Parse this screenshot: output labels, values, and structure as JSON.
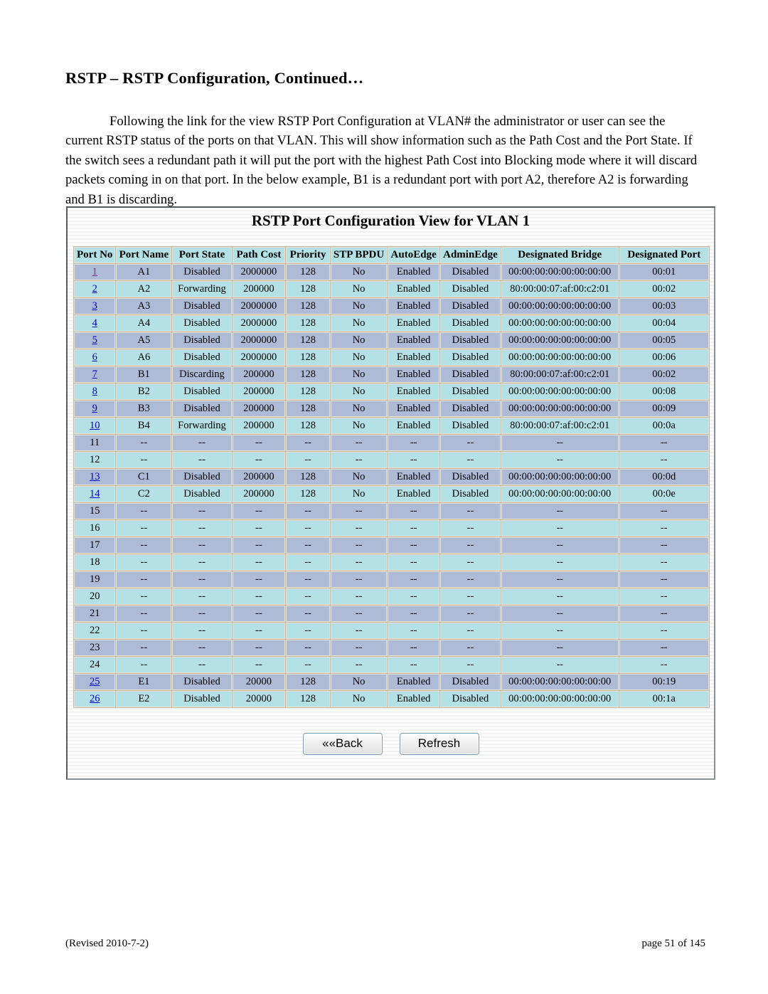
{
  "document": {
    "heading": "RSTP – RSTP Configuration, Continued…",
    "paragraph": "Following the link for the view RSTP Port Configuration at VLAN# the administrator or user can see the current RSTP status of the ports on that VLAN.  This will show information such as the Path Cost and the Port State.  If the switch sees a redundant path it will put the port with the highest Path Cost into Blocking mode where it will discard packets coming in on that port. In the below example, B1 is a redundant port with port A2, therefore A2 is forwarding and B1 is discarding.",
    "footer_left": "(Revised 2010-7-2)",
    "footer_right": "page 51 of 145"
  },
  "screenshot": {
    "title": "RSTP Port Configuration View for VLAN 1",
    "colors": {
      "header_bg": "#b4e1e6",
      "row_odd_bg": "#aebbd6",
      "row_even_bg": "#b4e1e6",
      "grid": "#e8e2d2",
      "link": "#0000cc",
      "link_visited": "#8c2a8c"
    },
    "table": {
      "columns": [
        "Port No",
        "Port Name",
        "Port State",
        "Path Cost",
        "Priority",
        "STP BPDU",
        "AutoEdge",
        "AdminEdge",
        "Designated Bridge",
        "Designated Port"
      ],
      "rows": [
        {
          "port_no": "1",
          "link": true,
          "visited": true,
          "port_name": "A1",
          "port_state": "Disabled",
          "path_cost": "2000000",
          "priority": "128",
          "stp_bpdu": "No",
          "auto_edge": "Enabled",
          "admin_edge": "Disabled",
          "designated_bridge": "00:00:00:00:00:00:00:00",
          "designated_port": "00:01"
        },
        {
          "port_no": "2",
          "link": true,
          "visited": false,
          "port_name": "A2",
          "port_state": "Forwarding",
          "path_cost": "200000",
          "priority": "128",
          "stp_bpdu": "No",
          "auto_edge": "Enabled",
          "admin_edge": "Disabled",
          "designated_bridge": "80:00:00:07:af:00:c2:01",
          "designated_port": "00:02"
        },
        {
          "port_no": "3",
          "link": true,
          "visited": false,
          "port_name": "A3",
          "port_state": "Disabled",
          "path_cost": "2000000",
          "priority": "128",
          "stp_bpdu": "No",
          "auto_edge": "Enabled",
          "admin_edge": "Disabled",
          "designated_bridge": "00:00:00:00:00:00:00:00",
          "designated_port": "00:03"
        },
        {
          "port_no": "4",
          "link": true,
          "visited": false,
          "port_name": "A4",
          "port_state": "Disabled",
          "path_cost": "2000000",
          "priority": "128",
          "stp_bpdu": "No",
          "auto_edge": "Enabled",
          "admin_edge": "Disabled",
          "designated_bridge": "00:00:00:00:00:00:00:00",
          "designated_port": "00:04"
        },
        {
          "port_no": "5",
          "link": true,
          "visited": false,
          "port_name": "A5",
          "port_state": "Disabled",
          "path_cost": "2000000",
          "priority": "128",
          "stp_bpdu": "No",
          "auto_edge": "Enabled",
          "admin_edge": "Disabled",
          "designated_bridge": "00:00:00:00:00:00:00:00",
          "designated_port": "00:05"
        },
        {
          "port_no": "6",
          "link": true,
          "visited": false,
          "port_name": "A6",
          "port_state": "Disabled",
          "path_cost": "2000000",
          "priority": "128",
          "stp_bpdu": "No",
          "auto_edge": "Enabled",
          "admin_edge": "Disabled",
          "designated_bridge": "00:00:00:00:00:00:00:00",
          "designated_port": "00:06"
        },
        {
          "port_no": "7",
          "link": true,
          "visited": false,
          "port_name": "B1",
          "port_state": "Discarding",
          "path_cost": "200000",
          "priority": "128",
          "stp_bpdu": "No",
          "auto_edge": "Enabled",
          "admin_edge": "Disabled",
          "designated_bridge": "80:00:00:07:af:00:c2:01",
          "designated_port": "00:02"
        },
        {
          "port_no": "8",
          "link": true,
          "visited": false,
          "port_name": "B2",
          "port_state": "Disabled",
          "path_cost": "200000",
          "priority": "128",
          "stp_bpdu": "No",
          "auto_edge": "Enabled",
          "admin_edge": "Disabled",
          "designated_bridge": "00:00:00:00:00:00:00:00",
          "designated_port": "00:08"
        },
        {
          "port_no": "9",
          "link": true,
          "visited": false,
          "port_name": "B3",
          "port_state": "Disabled",
          "path_cost": "200000",
          "priority": "128",
          "stp_bpdu": "No",
          "auto_edge": "Enabled",
          "admin_edge": "Disabled",
          "designated_bridge": "00:00:00:00:00:00:00:00",
          "designated_port": "00:09"
        },
        {
          "port_no": "10",
          "link": true,
          "visited": false,
          "port_name": "B4",
          "port_state": "Forwarding",
          "path_cost": "200000",
          "priority": "128",
          "stp_bpdu": "No",
          "auto_edge": "Enabled",
          "admin_edge": "Disabled",
          "designated_bridge": "80:00:00:07:af:00:c2:01",
          "designated_port": "00:0a"
        },
        {
          "port_no": "11",
          "link": false,
          "visited": false,
          "port_name": "--",
          "port_state": "--",
          "path_cost": "--",
          "priority": "--",
          "stp_bpdu": "--",
          "auto_edge": "--",
          "admin_edge": "--",
          "designated_bridge": "--",
          "designated_port": "--"
        },
        {
          "port_no": "12",
          "link": false,
          "visited": false,
          "port_name": "--",
          "port_state": "--",
          "path_cost": "--",
          "priority": "--",
          "stp_bpdu": "--",
          "auto_edge": "--",
          "admin_edge": "--",
          "designated_bridge": "--",
          "designated_port": "--"
        },
        {
          "port_no": "13",
          "link": true,
          "visited": false,
          "port_name": "C1",
          "port_state": "Disabled",
          "path_cost": "200000",
          "priority": "128",
          "stp_bpdu": "No",
          "auto_edge": "Enabled",
          "admin_edge": "Disabled",
          "designated_bridge": "00:00:00:00:00:00:00:00",
          "designated_port": "00:0d"
        },
        {
          "port_no": "14",
          "link": true,
          "visited": false,
          "port_name": "C2",
          "port_state": "Disabled",
          "path_cost": "200000",
          "priority": "128",
          "stp_bpdu": "No",
          "auto_edge": "Enabled",
          "admin_edge": "Disabled",
          "designated_bridge": "00:00:00:00:00:00:00:00",
          "designated_port": "00:0e"
        },
        {
          "port_no": "15",
          "link": false,
          "visited": false,
          "port_name": "--",
          "port_state": "--",
          "path_cost": "--",
          "priority": "--",
          "stp_bpdu": "--",
          "auto_edge": "--",
          "admin_edge": "--",
          "designated_bridge": "--",
          "designated_port": "--"
        },
        {
          "port_no": "16",
          "link": false,
          "visited": false,
          "port_name": "--",
          "port_state": "--",
          "path_cost": "--",
          "priority": "--",
          "stp_bpdu": "--",
          "auto_edge": "--",
          "admin_edge": "--",
          "designated_bridge": "--",
          "designated_port": "--"
        },
        {
          "port_no": "17",
          "link": false,
          "visited": false,
          "port_name": "--",
          "port_state": "--",
          "path_cost": "--",
          "priority": "--",
          "stp_bpdu": "--",
          "auto_edge": "--",
          "admin_edge": "--",
          "designated_bridge": "--",
          "designated_port": "--"
        },
        {
          "port_no": "18",
          "link": false,
          "visited": false,
          "port_name": "--",
          "port_state": "--",
          "path_cost": "--",
          "priority": "--",
          "stp_bpdu": "--",
          "auto_edge": "--",
          "admin_edge": "--",
          "designated_bridge": "--",
          "designated_port": "--"
        },
        {
          "port_no": "19",
          "link": false,
          "visited": false,
          "port_name": "--",
          "port_state": "--",
          "path_cost": "--",
          "priority": "--",
          "stp_bpdu": "--",
          "auto_edge": "--",
          "admin_edge": "--",
          "designated_bridge": "--",
          "designated_port": "--"
        },
        {
          "port_no": "20",
          "link": false,
          "visited": false,
          "port_name": "--",
          "port_state": "--",
          "path_cost": "--",
          "priority": "--",
          "stp_bpdu": "--",
          "auto_edge": "--",
          "admin_edge": "--",
          "designated_bridge": "--",
          "designated_port": "--"
        },
        {
          "port_no": "21",
          "link": false,
          "visited": false,
          "port_name": "--",
          "port_state": "--",
          "path_cost": "--",
          "priority": "--",
          "stp_bpdu": "--",
          "auto_edge": "--",
          "admin_edge": "--",
          "designated_bridge": "--",
          "designated_port": "--"
        },
        {
          "port_no": "22",
          "link": false,
          "visited": false,
          "port_name": "--",
          "port_state": "--",
          "path_cost": "--",
          "priority": "--",
          "stp_bpdu": "--",
          "auto_edge": "--",
          "admin_edge": "--",
          "designated_bridge": "--",
          "designated_port": "--"
        },
        {
          "port_no": "23",
          "link": false,
          "visited": false,
          "port_name": "--",
          "port_state": "--",
          "path_cost": "--",
          "priority": "--",
          "stp_bpdu": "--",
          "auto_edge": "--",
          "admin_edge": "--",
          "designated_bridge": "--",
          "designated_port": "--"
        },
        {
          "port_no": "24",
          "link": false,
          "visited": false,
          "port_name": "--",
          "port_state": "--",
          "path_cost": "--",
          "priority": "--",
          "stp_bpdu": "--",
          "auto_edge": "--",
          "admin_edge": "--",
          "designated_bridge": "--",
          "designated_port": "--"
        },
        {
          "port_no": "25",
          "link": true,
          "visited": false,
          "port_name": "E1",
          "port_state": "Disabled",
          "path_cost": "20000",
          "priority": "128",
          "stp_bpdu": "No",
          "auto_edge": "Enabled",
          "admin_edge": "Disabled",
          "designated_bridge": "00:00:00:00:00:00:00:00",
          "designated_port": "00:19"
        },
        {
          "port_no": "26",
          "link": true,
          "visited": false,
          "port_name": "E2",
          "port_state": "Disabled",
          "path_cost": "20000",
          "priority": "128",
          "stp_bpdu": "No",
          "auto_edge": "Enabled",
          "admin_edge": "Disabled",
          "designated_bridge": "00:00:00:00:00:00:00:00",
          "designated_port": "00:1a"
        }
      ]
    },
    "buttons": {
      "back_label": "««Back",
      "refresh_label": "Refresh"
    }
  }
}
